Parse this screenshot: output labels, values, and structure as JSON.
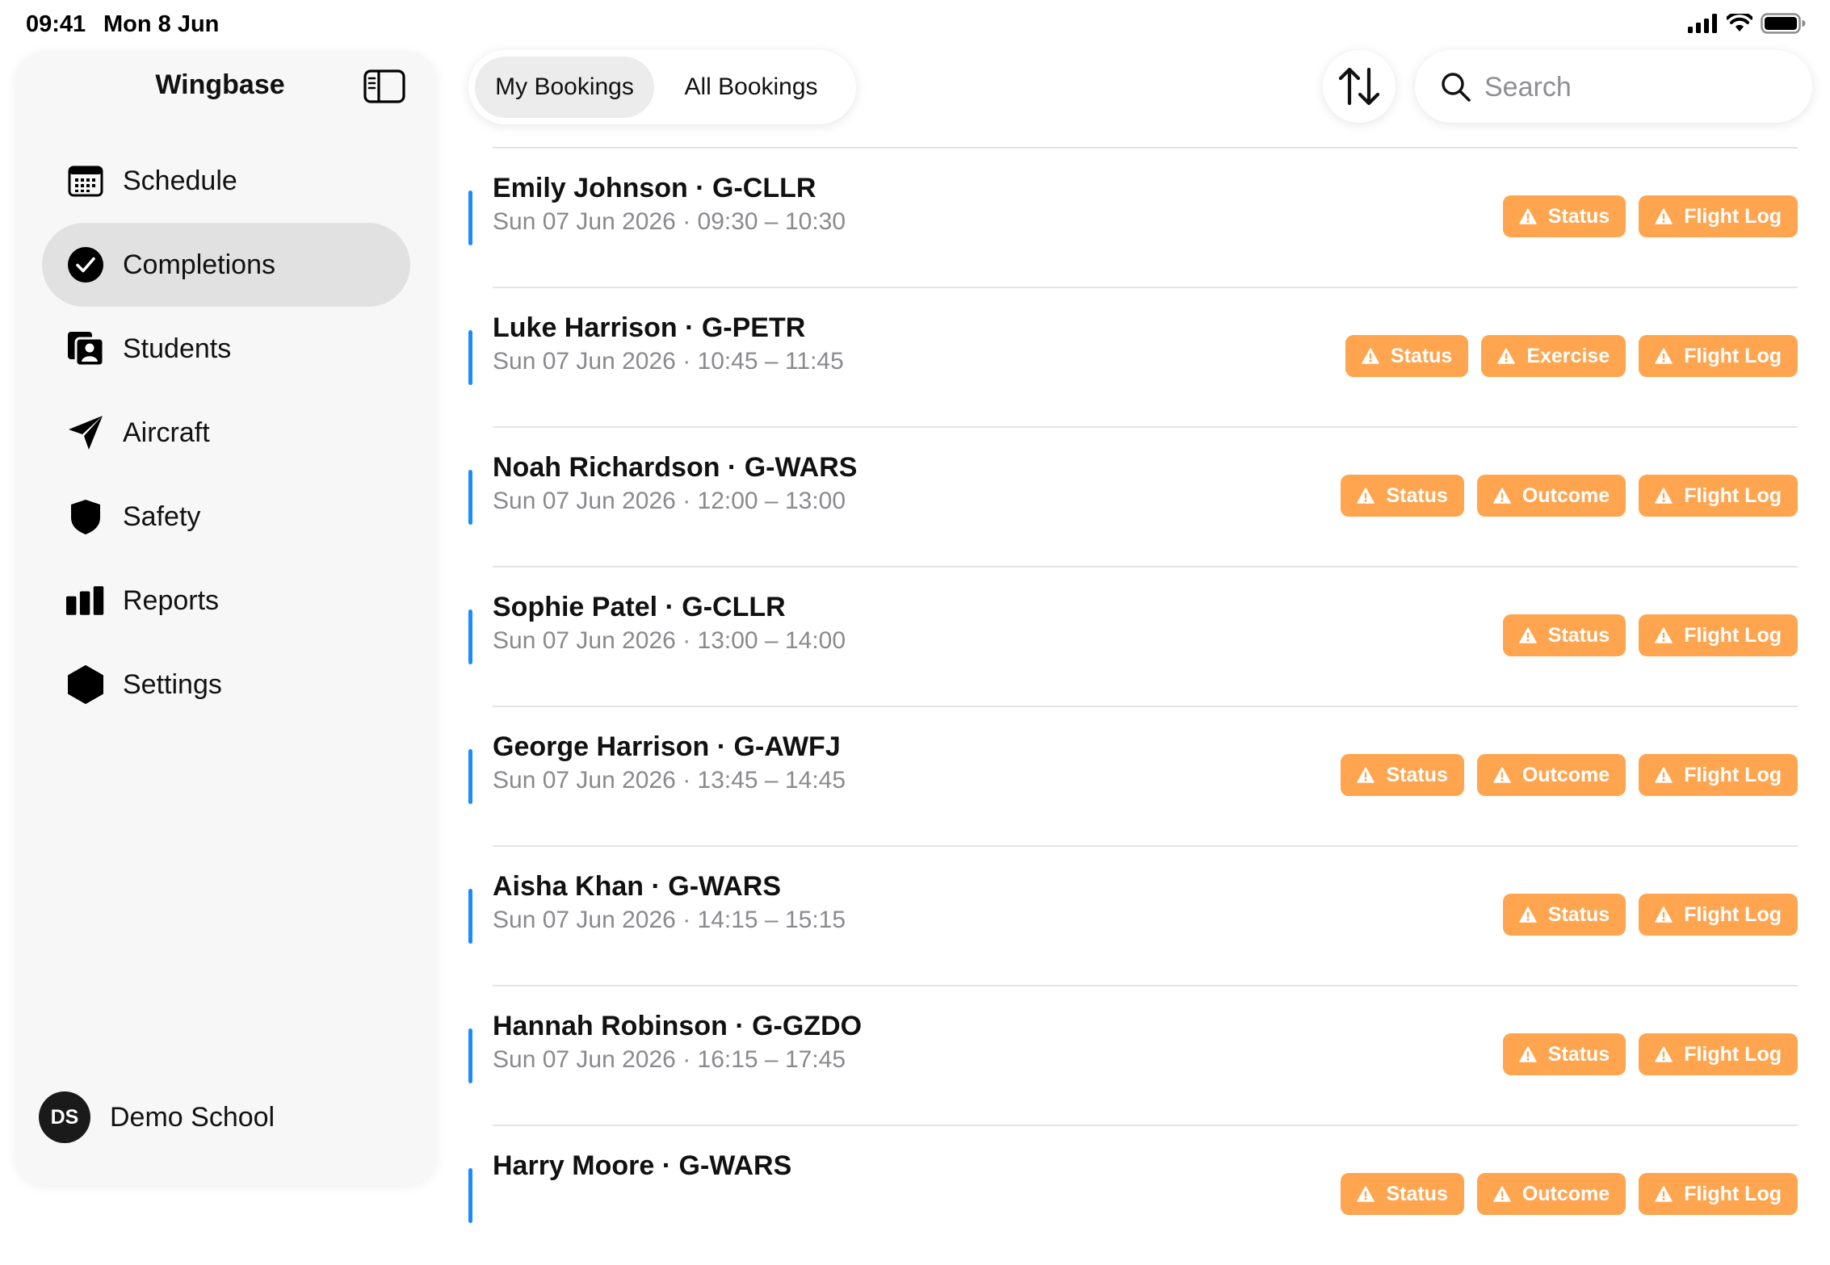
{
  "status_bar": {
    "time": "09:41",
    "date": "Mon 8 Jun"
  },
  "sidebar": {
    "title": "Wingbase",
    "items": [
      {
        "label": "Schedule",
        "icon": "calendar-icon",
        "active": false
      },
      {
        "label": "Completions",
        "icon": "checkmark-circle-icon",
        "active": true
      },
      {
        "label": "Students",
        "icon": "students-icon",
        "active": false
      },
      {
        "label": "Aircraft",
        "icon": "paperplane-icon",
        "active": false
      },
      {
        "label": "Safety",
        "icon": "shield-icon",
        "active": false
      },
      {
        "label": "Reports",
        "icon": "bar-chart-icon",
        "active": false
      },
      {
        "label": "Settings",
        "icon": "hexagon-icon",
        "active": false
      }
    ],
    "profile": {
      "initials": "DS",
      "name": "Demo School"
    }
  },
  "tabs": [
    {
      "label": "My Bookings",
      "active": true
    },
    {
      "label": "All Bookings",
      "active": false
    }
  ],
  "search": {
    "placeholder": "Search",
    "value": ""
  },
  "colors": {
    "accent": "#1a8cff",
    "warning": "#ffa54f",
    "active_nav": "#e1e1e1"
  },
  "bookings": [
    {
      "title": "Emily Johnson · G-CLLR",
      "subtitle": "Sun 07 Jun 2026 · 09:30 – 10:30",
      "badges": [
        "Status",
        "Flight Log"
      ]
    },
    {
      "title": "Luke Harrison · G-PETR",
      "subtitle": "Sun 07 Jun 2026 · 10:45 – 11:45",
      "badges": [
        "Status",
        "Exercise",
        "Flight Log"
      ]
    },
    {
      "title": "Noah Richardson · G-WARS",
      "subtitle": "Sun 07 Jun 2026 · 12:00 – 13:00",
      "badges": [
        "Status",
        "Outcome",
        "Flight Log"
      ]
    },
    {
      "title": "Sophie Patel · G-CLLR",
      "subtitle": "Sun 07 Jun 2026 · 13:00 – 14:00",
      "badges": [
        "Status",
        "Flight Log"
      ]
    },
    {
      "title": "George Harrison · G-AWFJ",
      "subtitle": "Sun 07 Jun 2026 · 13:45 – 14:45",
      "badges": [
        "Status",
        "Outcome",
        "Flight Log"
      ]
    },
    {
      "title": "Aisha Khan · G-WARS",
      "subtitle": "Sun 07 Jun 2026 · 14:15 – 15:15",
      "badges": [
        "Status",
        "Flight Log"
      ]
    },
    {
      "title": "Hannah Robinson · G-GZDO",
      "subtitle": "Sun 07 Jun 2026 · 16:15 – 17:45",
      "badges": [
        "Status",
        "Flight Log"
      ]
    },
    {
      "title": "Harry Moore · G-WARS",
      "subtitle": "",
      "badges": [
        "Status",
        "Outcome",
        "Flight Log"
      ]
    }
  ]
}
